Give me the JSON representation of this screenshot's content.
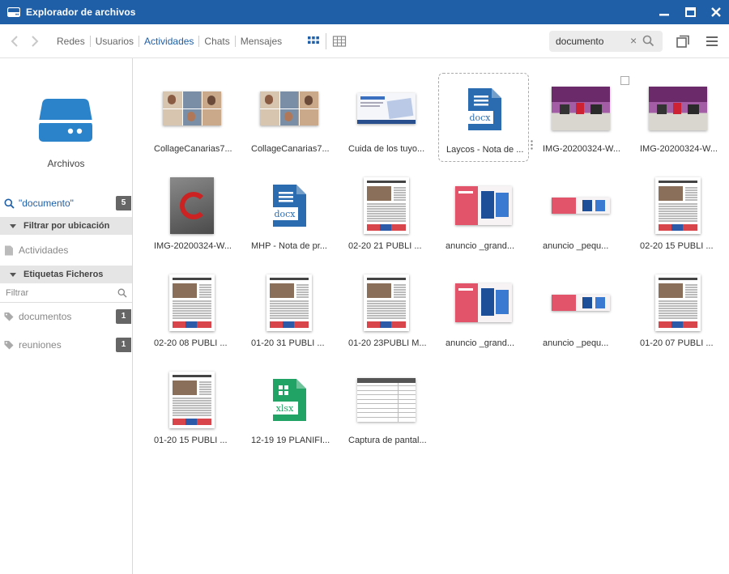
{
  "window": {
    "title": "Explorador de archivos"
  },
  "toolbar": {
    "tabs": [
      {
        "label": "Redes",
        "active": false
      },
      {
        "label": "Usuarios",
        "active": false
      },
      {
        "label": "Actividades",
        "active": true
      },
      {
        "label": "Chats",
        "active": false
      },
      {
        "label": "Mensajes",
        "active": false
      }
    ],
    "search": {
      "value": "documento",
      "clear_glyph": "×"
    }
  },
  "sidebar": {
    "drive_label": "Archivos",
    "search_term": "\"documento\"",
    "search_count": "5",
    "section_location": "Filtrar por ubicación",
    "location_items": [
      {
        "label": "Actividades"
      }
    ],
    "section_tags": "Etiquetas Ficheros",
    "filter_placeholder": "Filtrar",
    "tags": [
      {
        "label": "documentos",
        "count": "1"
      },
      {
        "label": "reuniones",
        "count": "1"
      }
    ]
  },
  "files": [
    {
      "name": "CollageCanarias7...",
      "kind": "collage"
    },
    {
      "name": "CollageCanarias7...",
      "kind": "collage"
    },
    {
      "name": "Cuida de los tuyo...",
      "kind": "web"
    },
    {
      "name": "Laycos - Nota de ...",
      "kind": "docx",
      "ext": "docx",
      "selected": true
    },
    {
      "name": "IMG-20200324-W...",
      "kind": "photo-purple"
    },
    {
      "name": "IMG-20200324-W...",
      "kind": "photo-purple"
    },
    {
      "name": "IMG-20200324-W...",
      "kind": "photo-red"
    },
    {
      "name": "MHP - Nota de pr...",
      "kind": "docx",
      "ext": "docx"
    },
    {
      "name": "02-20 21 PUBLI ...",
      "kind": "news"
    },
    {
      "name": "anuncio _grand...",
      "kind": "ad-large"
    },
    {
      "name": "anuncio _pequ...",
      "kind": "ad-small"
    },
    {
      "name": "02-20 15 PUBLI ...",
      "kind": "news"
    },
    {
      "name": "02-20 08 PUBLI ...",
      "kind": "news"
    },
    {
      "name": "01-20 31 PUBLI ...",
      "kind": "news"
    },
    {
      "name": "01-20 23PUBLI M...",
      "kind": "news"
    },
    {
      "name": "anuncio _grand...",
      "kind": "ad-large"
    },
    {
      "name": "anuncio _pequ...",
      "kind": "ad-small"
    },
    {
      "name": "01-20 07 PUBLI ...",
      "kind": "news"
    },
    {
      "name": "01-20 15 PUBLI ...",
      "kind": "news"
    },
    {
      "name": "12-19 19 PLANIFI...",
      "kind": "xlsx",
      "ext": "xlsx"
    },
    {
      "name": "Captura de pantal...",
      "kind": "table-shot"
    }
  ],
  "colors": {
    "accent": "#1f5fa8",
    "docx": "#2b6cb0",
    "xlsx": "#21a366"
  }
}
